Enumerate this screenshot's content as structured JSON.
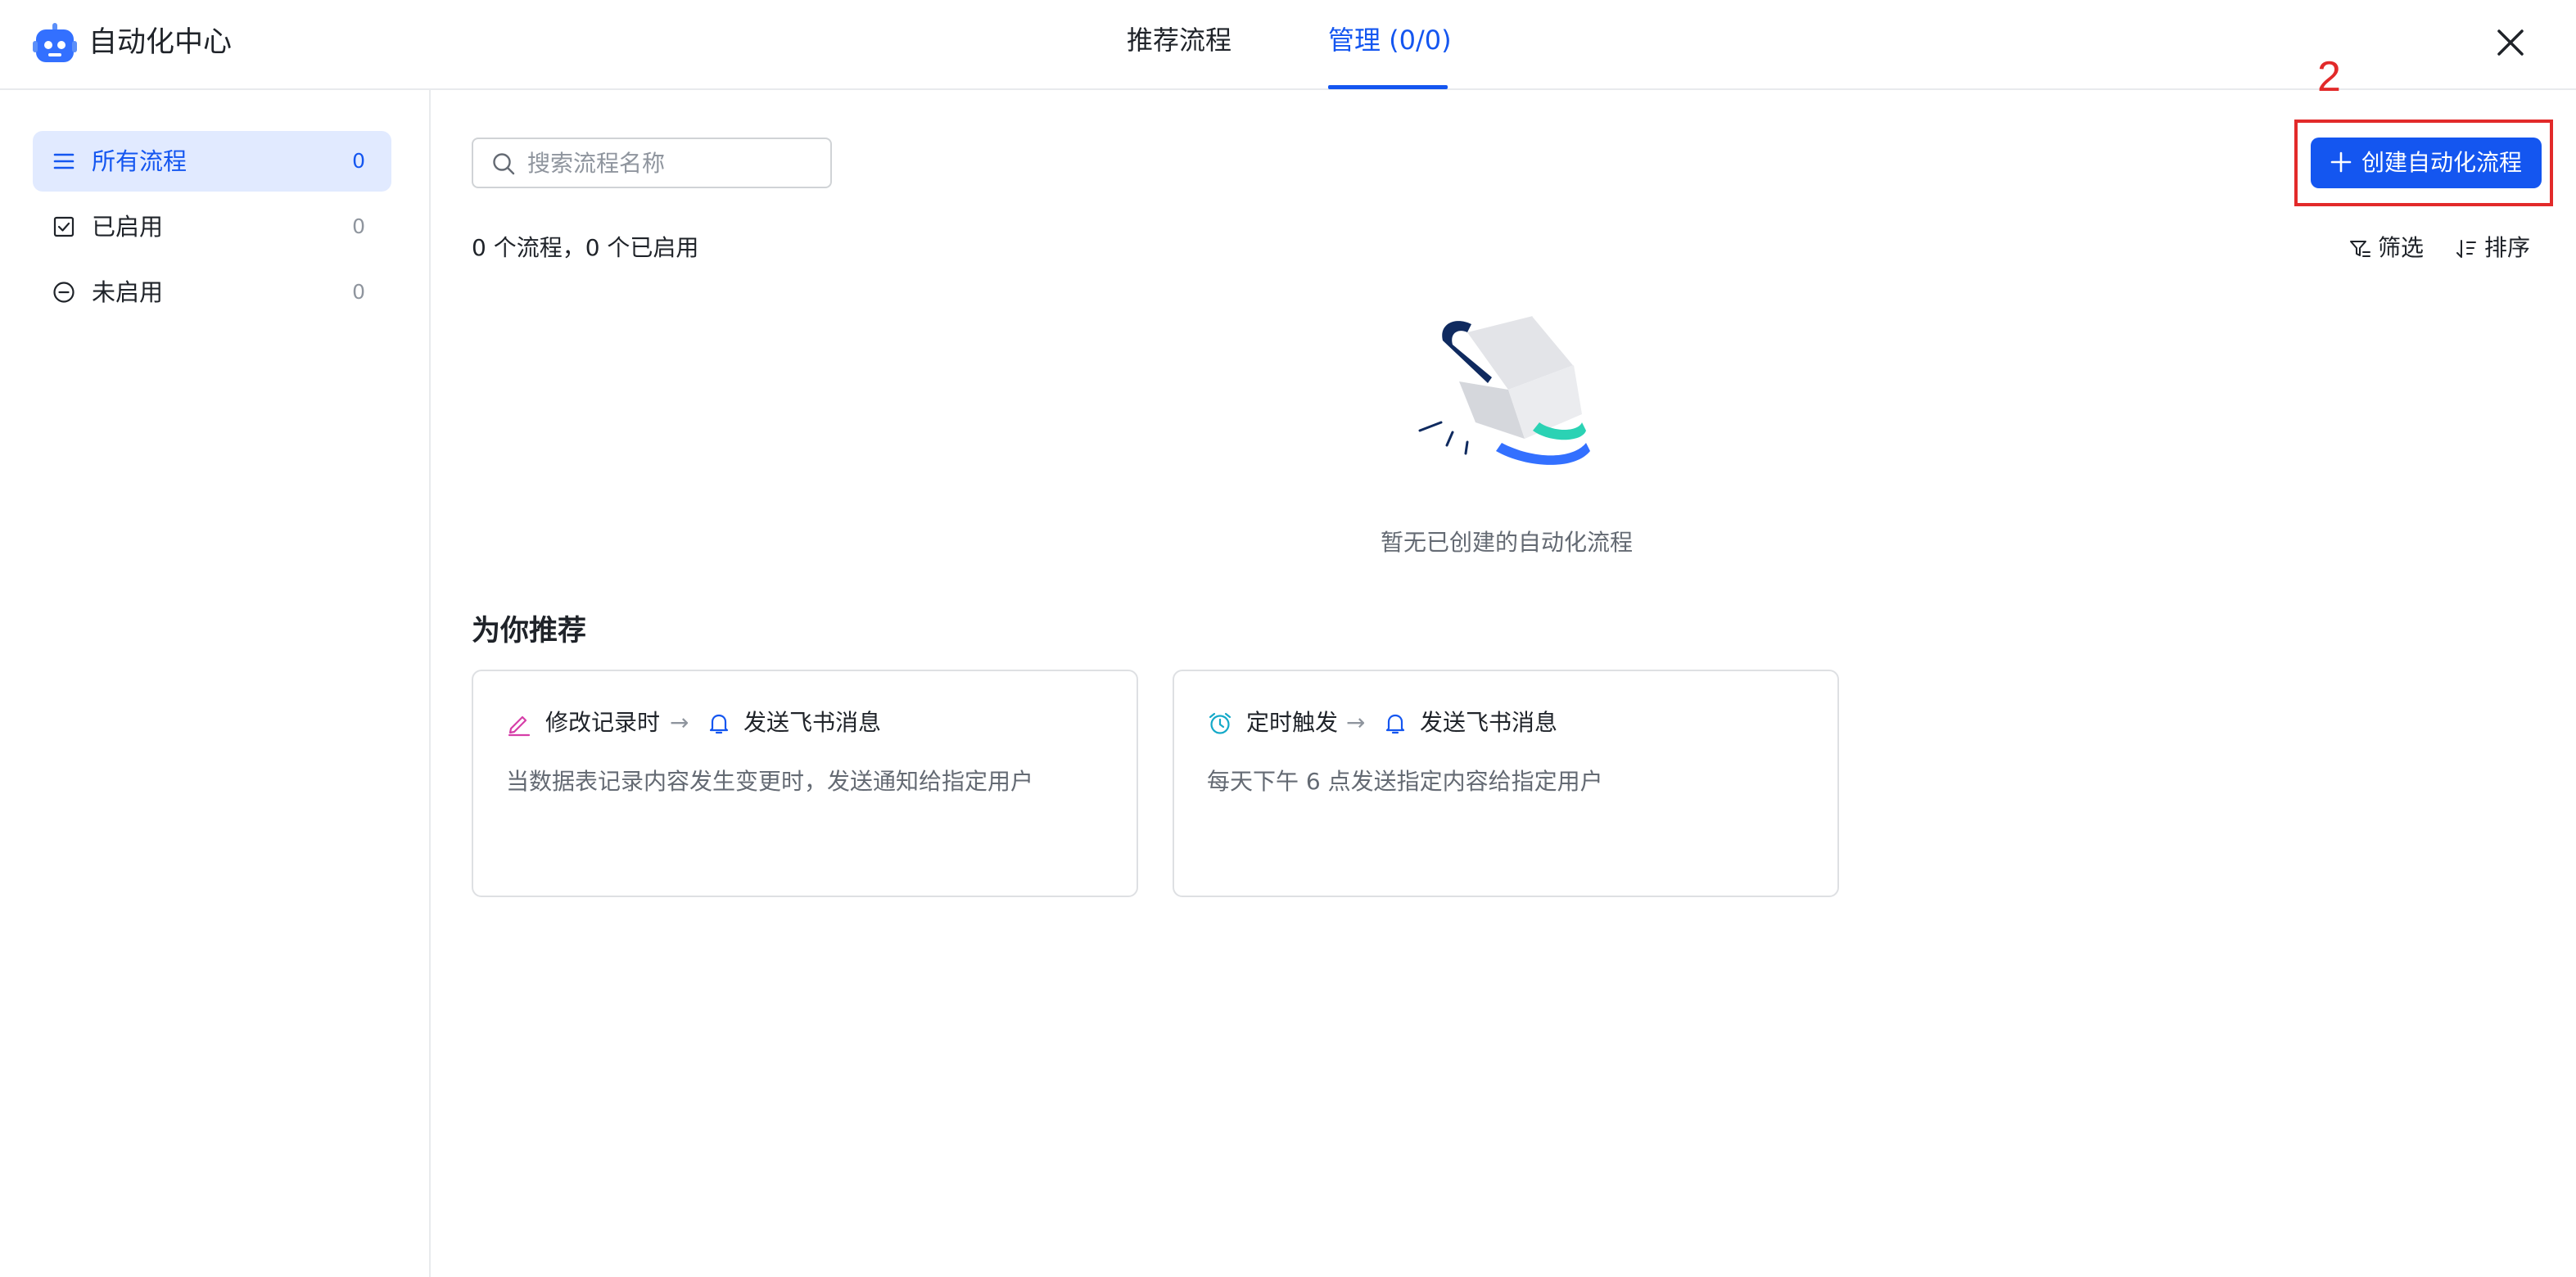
{
  "app": {
    "title": "自动化中心",
    "logo_icon": "robot-icon"
  },
  "tabs": [
    {
      "label": "推荐流程",
      "active": false
    },
    {
      "label": "管理 (0/0)",
      "active": true
    }
  ],
  "colors": {
    "accent": "#1456f0",
    "annotation": "#e22a2a",
    "active_bg": "#e1eaff"
  },
  "sidebar": {
    "items": [
      {
        "label": "所有流程",
        "count": "0",
        "icon": "list-icon",
        "active": true
      },
      {
        "label": "已启用",
        "count": "0",
        "icon": "checkbox-checked-icon",
        "active": false
      },
      {
        "label": "未启用",
        "count": "0",
        "icon": "minus-circle-icon",
        "active": false
      }
    ]
  },
  "search": {
    "placeholder": "搜索流程名称",
    "value": ""
  },
  "toolbar": {
    "create_label": "创建自动化流程",
    "summary": "0 个流程，0 个已启用",
    "filter_label": "筛选",
    "sort_label": "排序"
  },
  "annotation": {
    "number": "2"
  },
  "empty": {
    "text": "暂无已创建的自动化流程"
  },
  "recommend": {
    "title": "为你推荐",
    "cards": [
      {
        "trigger": "修改记录时",
        "trigger_icon": "edit-pen-icon",
        "arrow": "→",
        "action": "发送飞书消息",
        "action_icon": "bell-icon",
        "desc": "当数据表记录内容发生变更时，发送通知给指定用户"
      },
      {
        "trigger": "定时触发",
        "trigger_icon": "alarm-clock-icon",
        "arrow": "→",
        "action": "发送飞书消息",
        "action_icon": "bell-icon",
        "desc": "每天下午 6 点发送指定内容给指定用户"
      }
    ]
  }
}
